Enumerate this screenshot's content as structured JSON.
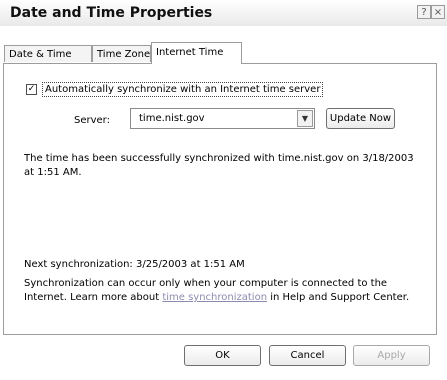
{
  "window": {
    "title": "Date and Time Properties",
    "help_glyph": "?",
    "close_glyph": "×"
  },
  "tabs": [
    {
      "label": "Date & Time"
    },
    {
      "label": "Time Zone"
    },
    {
      "label": "Internet Time",
      "selected": true
    }
  ],
  "internet_time": {
    "auto_sync_label": "Automatically synchronize with an Internet time server",
    "auto_sync_checked": true,
    "server_label": "Server:",
    "server_value": "time.nist.gov",
    "update_button": "Update Now",
    "status_message": "The time has been successfully synchronized with time.nist.gov on 3/18/2003 at 1:51 AM.",
    "next_sync": "Next synchronization: 3/25/2003 at 1:51 AM",
    "note_prefix": "Synchronization can occur only when your computer is connected to the Internet. Learn more about ",
    "note_link": "time synchronization",
    "note_suffix": " in Help and Support Center."
  },
  "buttons": {
    "ok": "OK",
    "cancel": "Cancel",
    "apply": "Apply"
  },
  "icons": {
    "checkbox": "checkmark-icon",
    "dropdown": "chevron-down-icon"
  }
}
